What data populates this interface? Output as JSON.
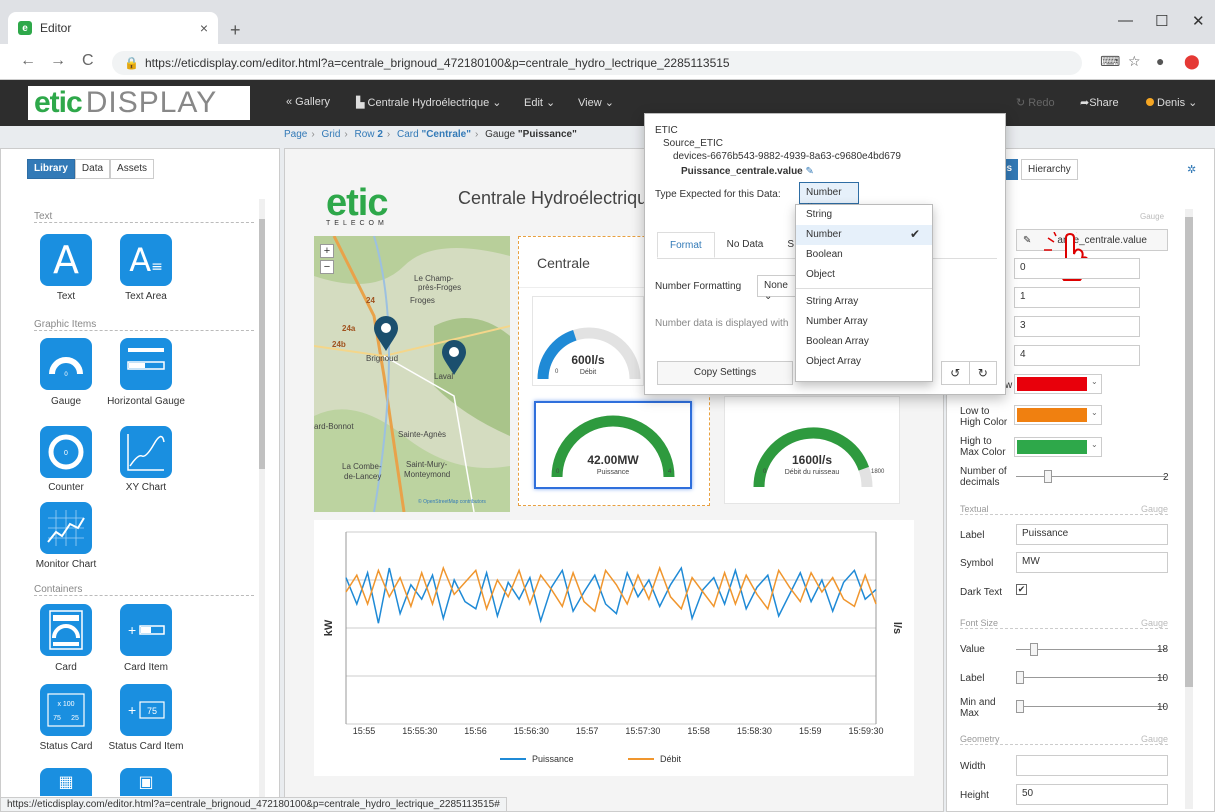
{
  "browser": {
    "tab_title": "Editor",
    "tab_close": "×",
    "new_tab": "+",
    "url": "https://eticdisplay.com/editor.html?a=centrale_brignoud_472180100&p=centrale_hydro_lectrique_2285113515",
    "status_url": "https://eticdisplay.com/editor.html?a=centrale_brignoud_472180100&p=centrale_hydro_lectrique_2285113515#"
  },
  "app": {
    "logo_main": "etic",
    "logo_sub": "DISPLAY",
    "menu": {
      "gallery": "« Gallery",
      "page": "Centrale Hydroélectrique ⌄",
      "edit": "Edit ⌄",
      "view": "View ⌄",
      "redo": "Redo",
      "share": "Share",
      "user": "Denis ⌄"
    }
  },
  "breadcrumb": {
    "page": "Page",
    "grid": "Grid",
    "row": "Row",
    "row_num": "2",
    "card": "Card",
    "card_name": "\"Centrale\"",
    "gauge": "Gauge",
    "gauge_name": "\"Puissance\""
  },
  "left_panel": {
    "tabs": [
      "Library",
      "Data",
      "Assets"
    ],
    "sections": {
      "text": "Text",
      "graphic": "Graphic Items",
      "containers": "Containers"
    },
    "items": {
      "text": "Text",
      "text_area": "Text Area",
      "gauge": "Gauge",
      "horizontal_gauge": "Horizontal Gauge",
      "counter": "Counter",
      "xy_chart": "XY Chart",
      "monitor_chart": "Monitor Chart",
      "card": "Card",
      "card_item": "Card Item",
      "status_card": "Status Card",
      "status_card_item": "Status Card Item"
    },
    "icon_text": {
      "counter_zero": "0",
      "gauge_zero": "0",
      "sc_x100": "x 100",
      "sc_75": "75",
      "sc_25": "25",
      "sci_75": "75"
    }
  },
  "canvas": {
    "logo_main": "etic",
    "logo_sub": "TELECOM",
    "title": "Centrale Hydroélectrique",
    "map_labels": {
      "le_champ": "Le Champ-",
      "pres_froges": "près-Froges",
      "froges": "Froges",
      "brignoud": "Brignoud",
      "laval": "Laval",
      "bonnot": "ard-Bonnot",
      "agnes": "Sainte-Agnès",
      "la_combe": "La Combe-",
      "de_lancey": "de-Lancey",
      "saint_mury": "Saint-Mury-",
      "monteymond": "Monteymond",
      "road1": "24",
      "road2": "24a",
      "road3": "24b",
      "attribution": "© OpenStreetMap contributors",
      "zoom_in": "+",
      "zoom_out": "−"
    },
    "card_title": "Centrale",
    "gauges": [
      {
        "value": "600l/s",
        "label": "Débit",
        "min": "0",
        "max": "",
        "fill": 0.4
      },
      {
        "value": "42.00MW",
        "label": "Puissance",
        "min": "0",
        "max": "4",
        "fill": 1.0
      },
      {
        "value": "1600l/s",
        "label": "Débit du ruisseau",
        "min": "0",
        "max": "1800",
        "fill": 0.89
      }
    ]
  },
  "chart_data": {
    "type": "line",
    "x_ticks": [
      "15:55",
      "15:55:30",
      "15:56",
      "15:56:30",
      "15:57",
      "15:57:30",
      "15:58",
      "15:58:30",
      "15:59",
      "15:59:30"
    ],
    "ylabel_left": "kW",
    "ylabel_right": "l/s",
    "series": [
      {
        "name": "Puissance",
        "color": "#1f8ad6",
        "values": [
          6.1,
          5.0,
          6.3,
          4.2,
          6.5,
          4.6,
          5.8,
          5.2,
          6.2,
          4.4,
          6.0,
          5.1,
          4.8,
          6.3,
          4.5,
          5.9,
          5.2,
          6.1,
          4.3,
          5.7,
          6.4,
          4.7,
          5.5,
          6.2,
          5.0,
          4.6,
          6.3,
          5.3,
          6.0,
          4.9,
          5.8,
          6.5,
          4.4,
          5.6,
          6.1,
          5.0,
          6.4,
          4.8,
          5.7,
          6.2,
          4.5,
          5.4,
          6.3,
          5.1,
          6.0,
          4.7,
          5.9,
          6.4,
          5.2,
          5.6
        ]
      },
      {
        "name": "Débit",
        "color": "#f0962e",
        "values": [
          5.5,
          6.2,
          5.0,
          6.4,
          5.3,
          6.1,
          4.9,
          6.3,
          5.0,
          6.5,
          5.4,
          5.9,
          6.4,
          4.8,
          6.0,
          5.3,
          6.4,
          5.0,
          6.2,
          5.6,
          4.9,
          6.3,
          5.1,
          4.7,
          6.4,
          5.8,
          5.0,
          6.2,
          5.2,
          6.5,
          5.3,
          4.8,
          6.1,
          5.5,
          4.9,
          6.3,
          5.0,
          6.2,
          5.4,
          4.8,
          6.4,
          5.7,
          5.1,
          6.3,
          5.5,
          6.1,
          5.2,
          4.9,
          6.2,
          5.0
        ]
      }
    ]
  },
  "popup": {
    "tree_root": "ETIC",
    "tree_source": "Source_ETIC",
    "tree_device": "devices-6676b543-9882-4939-8a63-c9680e4bd679",
    "tree_value": "Puissance_centrale.value",
    "type_label": "Type Expected for this Data:",
    "type_value": "Number ⌄",
    "tabs": [
      "Format",
      "No Data",
      "S"
    ],
    "number_formatting_label": "Number Formatting",
    "number_formatting_value": "None ⌄",
    "description": "Number data is displayed with",
    "copy_settings": "Copy Settings",
    "options": [
      "String",
      "Number",
      "Boolean",
      "Object",
      "String Array",
      "Number Array",
      "Boolean Array",
      "Object Array"
    ],
    "selected_option": "Number",
    "check": "✔"
  },
  "right_panel": {
    "tab_properties": "es",
    "tab_hierarchy": "Hierarchy",
    "gauge_header": "Gauge",
    "binding_value": "Puissance_centrale.value",
    "binding_visible": "ance_centrale.value",
    "inputs": [
      "0",
      "1",
      "3",
      "4"
    ],
    "colors": [
      {
        "label": "Low to Medium Color",
        "label_visible": "w",
        "color": "#e8000b"
      },
      {
        "label": "Low to High Color",
        "label_visible": "Low to High Color",
        "color": "#f08010"
      },
      {
        "label": "High to Max Color",
        "label_visible": "High to Max Color",
        "color": "#2ea84a"
      }
    ],
    "decimals_label": "Number of decimals",
    "decimals_value": "2",
    "textual_header": "Textual",
    "label_label": "Label",
    "label_value": "Puissance",
    "symbol_label": "Symbol",
    "symbol_value": "MW",
    "dark_text_label": "Dark Text",
    "dark_text_check": "✔",
    "font_size_header": "Font Size",
    "font_value_label": "Value",
    "font_value": "18",
    "font_label_label": "Label",
    "font_label": "10",
    "font_minmax_label": "Min and Max",
    "font_minmax": "10",
    "geometry_header": "Geometry",
    "width_label": "Width",
    "width_value": "",
    "height_label": "Height",
    "height_value": "50"
  }
}
